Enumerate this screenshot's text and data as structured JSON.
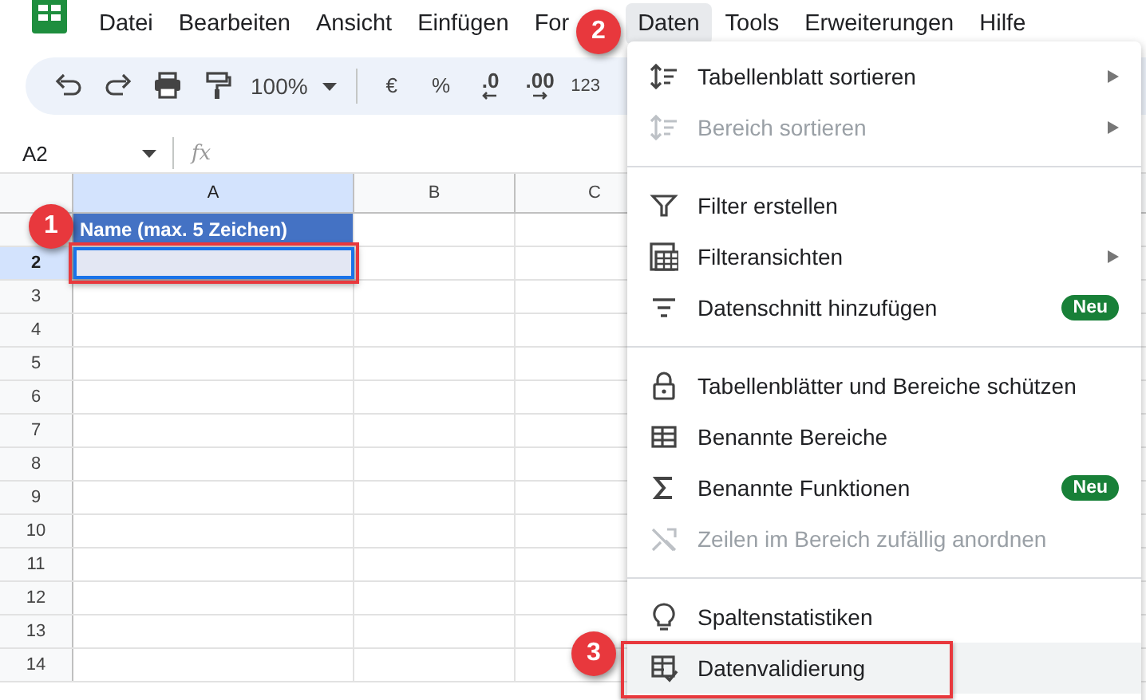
{
  "menu_bar": [
    {
      "label": "Datei",
      "selected": false
    },
    {
      "label": "Bearbeiten",
      "selected": false
    },
    {
      "label": "Ansicht",
      "selected": false
    },
    {
      "label": "Einfügen",
      "selected": false
    },
    {
      "label": "For",
      "selected": false
    },
    {
      "label": "Daten",
      "selected": true
    },
    {
      "label": "Tools",
      "selected": false
    },
    {
      "label": "Erweiterungen",
      "selected": false
    },
    {
      "label": "Hilfe",
      "selected": false
    }
  ],
  "toolbar": {
    "zoom": "100%",
    "format_buttons": [
      "€",
      "%",
      ".0",
      ".00",
      "123"
    ]
  },
  "formula_bar": {
    "name_box": "A2",
    "function_label": "fx"
  },
  "sheet": {
    "columns": [
      {
        "label": "A",
        "selected": true
      },
      {
        "label": "B",
        "selected": false
      },
      {
        "label": "C",
        "selected": false
      }
    ],
    "rows": [
      {
        "selected": false,
        "kind": "header",
        "cell": "Name (max. 5 Zeichen)",
        "outlined": false
      },
      {
        "number": "2",
        "selected": true,
        "kind": "active",
        "outlined": true
      },
      {
        "number": "3",
        "selected": false,
        "kind": "plain",
        "outlined": false
      },
      {
        "number": "4",
        "selected": false,
        "kind": "plain",
        "outlined": false
      },
      {
        "number": "5",
        "selected": false,
        "kind": "plain",
        "outlined": false
      },
      {
        "number": "6",
        "selected": false,
        "kind": "plain",
        "outlined": false
      },
      {
        "number": "7",
        "selected": false,
        "kind": "plain",
        "outlined": false
      },
      {
        "number": "8",
        "selected": false,
        "kind": "plain",
        "outlined": false
      },
      {
        "number": "9",
        "selected": false,
        "kind": "plain",
        "outlined": false
      },
      {
        "number": "10",
        "selected": false,
        "kind": "plain",
        "outlined": false
      },
      {
        "number": "11",
        "selected": false,
        "kind": "plain",
        "outlined": false
      },
      {
        "number": "12",
        "selected": false,
        "kind": "plain",
        "outlined": false
      },
      {
        "number": "13",
        "selected": false,
        "kind": "plain",
        "outlined": false
      },
      {
        "number": "14",
        "selected": false,
        "kind": "plain",
        "outlined": false
      }
    ]
  },
  "data_menu": [
    {
      "kind": "item",
      "label": "Tabellenblatt sortieren",
      "disabled": false,
      "submenu": true,
      "highlighted": false,
      "outlined": false
    },
    {
      "kind": "item",
      "label": "Bereich sortieren",
      "disabled": true,
      "submenu": true,
      "highlighted": false,
      "outlined": false
    },
    {
      "kind": "divider"
    },
    {
      "kind": "item",
      "label": "Filter erstellen",
      "disabled": false,
      "submenu": false,
      "highlighted": false,
      "outlined": false
    },
    {
      "kind": "item",
      "label": "Filteransichten",
      "disabled": false,
      "submenu": true,
      "highlighted": false,
      "outlined": false
    },
    {
      "kind": "item",
      "label": "Datenschnitt hinzufügen",
      "disabled": false,
      "submenu": false,
      "badge": "Neu",
      "highlighted": false,
      "outlined": false
    },
    {
      "kind": "divider"
    },
    {
      "kind": "item",
      "label": "Tabellenblätter und Bereiche schützen",
      "disabled": false,
      "submenu": false,
      "highlighted": false,
      "outlined": false
    },
    {
      "kind": "item",
      "label": "Benannte Bereiche",
      "disabled": false,
      "submenu": false,
      "highlighted": false,
      "outlined": false
    },
    {
      "kind": "item",
      "label": "Benannte Funktionen",
      "disabled": false,
      "submenu": false,
      "badge": "Neu",
      "highlighted": false,
      "outlined": false
    },
    {
      "kind": "item",
      "label": "Zeilen im Bereich zufällig anordnen",
      "disabled": true,
      "submenu": false,
      "highlighted": false,
      "outlined": false
    },
    {
      "kind": "divider"
    },
    {
      "kind": "item",
      "label": "Spaltenstatistiken",
      "disabled": false,
      "submenu": false,
      "highlighted": false,
      "outlined": false
    },
    {
      "kind": "item",
      "label": "Datenvalidierung",
      "disabled": false,
      "submenu": false,
      "highlighted": true,
      "outlined": true
    }
  ],
  "callouts": [
    {
      "number": "1"
    },
    {
      "number": "2"
    },
    {
      "number": "3"
    }
  ]
}
